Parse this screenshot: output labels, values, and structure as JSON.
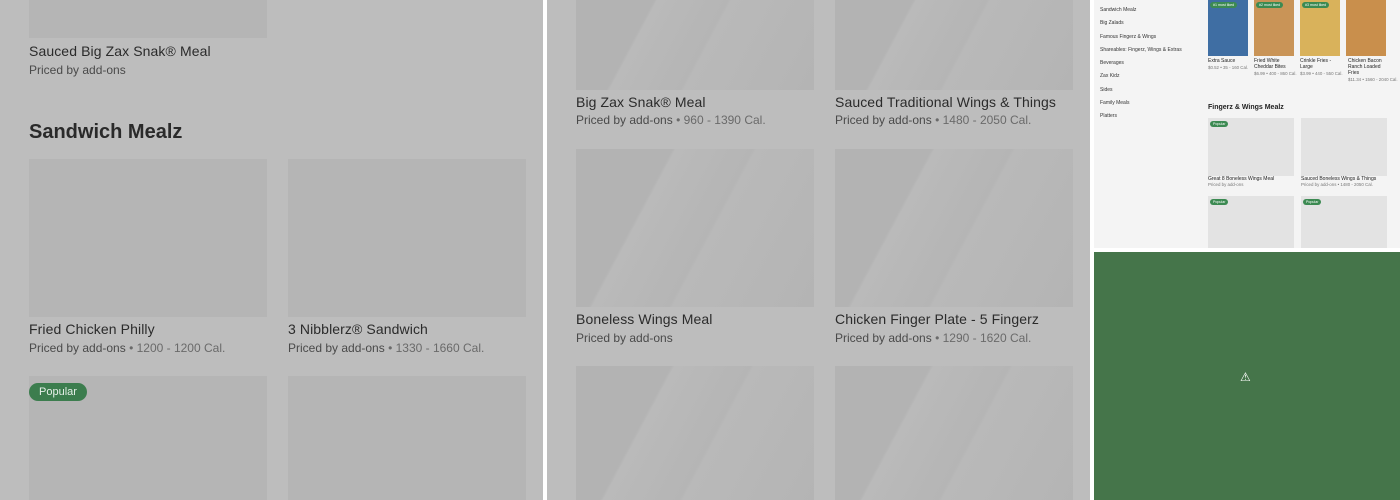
{
  "panel_left": {
    "top_item": {
      "name": "Sauced Big Zax Snak® Meal",
      "meta": "Priced by add-ons"
    },
    "section_title": "Sandwich Mealz",
    "items": [
      {
        "name": "Fried Chicken Philly",
        "meta": "Priced by add-ons",
        "cal": " • 1200 - 1200 Cal."
      },
      {
        "name": "3 Nibblerz® Sandwich",
        "meta": "Priced by add-ons",
        "cal": " • 1330 - 1660 Cal."
      }
    ],
    "popular_badge": "Popular"
  },
  "panel_middle": {
    "items": [
      {
        "name": "Big Zax Snak® Meal",
        "meta": "Priced by add-ons",
        "cal": " • 960 - 1390 Cal."
      },
      {
        "name": "Sauced Traditional Wings & Things",
        "meta": "Priced by add-ons",
        "cal": " • 1480 - 2050 Cal."
      },
      {
        "name": "Boneless Wings Meal",
        "meta": "Priced by add-ons",
        "cal": ""
      },
      {
        "name": "Chicken Finger Plate - 5 Fingerz",
        "meta": "Priced by add-ons",
        "cal": " • 1290 - 1620 Cal."
      }
    ]
  },
  "mini_screenshot": {
    "nav": [
      "Sandwich Mealz",
      "Big Zalads",
      "Famous Fingerz & Wings",
      "Shareables: Fingerz, Wings & Extras",
      "Beverages",
      "Zax Kidz",
      "Sides",
      "Family Meals",
      "Platters"
    ],
    "products": [
      {
        "badge": "#1 most liked",
        "name": "Extra Sauce",
        "meta": "$0.52 • 35 - 160 Cal.",
        "color": "#3f6ea3"
      },
      {
        "badge": "#2 most liked",
        "name": "Fried White Cheddar Bites",
        "meta": "$6.99 • 400 - 860 Cal.",
        "color": "#c99457"
      },
      {
        "badge": "#3 most liked",
        "name": "Crinkle Fries - Large",
        "meta": "$3.99 • 440 - 550 Cal.",
        "color": "#d9b25b"
      },
      {
        "badge": "",
        "name": "Chicken Bacon Ranch Loaded Fries",
        "meta": "$11.34 • 1560 - 2040 Cal.",
        "color": "#c98f4c"
      }
    ],
    "section_title": "Fingerz & Wings Mealz",
    "section_items": [
      {
        "badge": "Popular",
        "name": "Great 8 Boneless Wings Meal",
        "meta": "Priced by add-ons"
      },
      {
        "badge": "",
        "name": "Sauced Boneless Wings & Things",
        "meta": "Priced by add-ons • 1480 - 2050 Cal."
      }
    ],
    "bottom_badges": [
      "Popular",
      "Popular"
    ]
  },
  "broken_image": {
    "icon": "⚠",
    "color": "#45754a"
  }
}
